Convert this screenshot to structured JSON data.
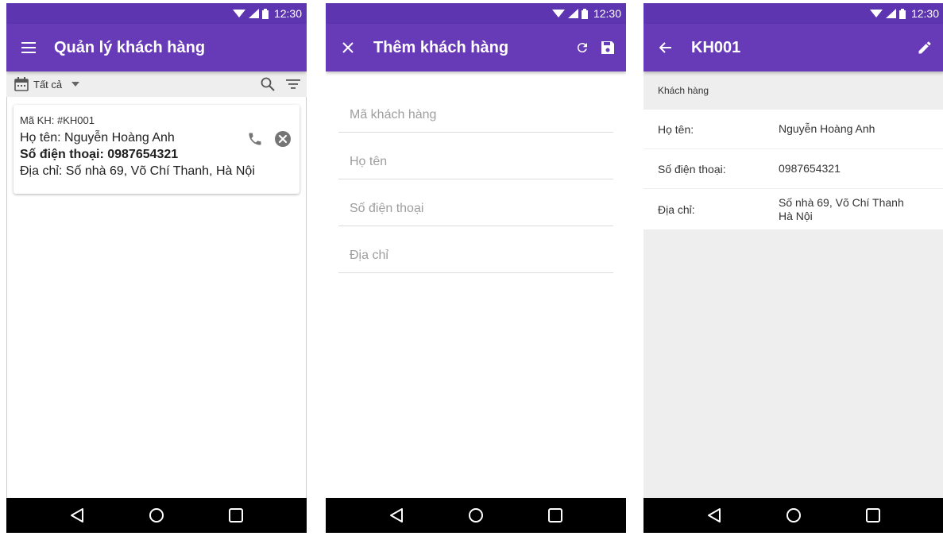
{
  "status": {
    "time": "12:30"
  },
  "screens": {
    "list": {
      "title": "Quản lý khách hàng",
      "filter_label": "Tất cả",
      "customer": {
        "code": "Mã KH: #KH001",
        "name": "Họ tên: Nguyễn Hoàng Anh",
        "phone": "Số điện thoại: 0987654321",
        "address": "Địa chỉ: Số nhà 69, Võ Chí Thanh, Hà Nội"
      }
    },
    "add": {
      "title": "Thêm khách hàng",
      "fields": {
        "code_placeholder": "Mã khách hàng",
        "name_placeholder": "Họ tên",
        "phone_placeholder": "Số điện thoại",
        "address_placeholder": "Địa chỉ"
      }
    },
    "detail": {
      "title": "KH001",
      "section": "Khách hàng",
      "rows": [
        {
          "label": "Họ tên:",
          "value": "Nguyễn Hoàng Anh"
        },
        {
          "label": "Số điện thoại:",
          "value": "0987654321"
        },
        {
          "label": "Địa chỉ:",
          "value": "Số nhà 69, Võ Chí Thanh Hà Nội"
        }
      ]
    }
  },
  "icons": {
    "menu": "menu-icon",
    "calendar": "calendar-icon",
    "dropdown": "dropdown-arrow-icon",
    "search": "search-icon",
    "filter": "filter-icon",
    "phone": "phone-icon",
    "delete": "delete-circle-icon",
    "close": "close-icon",
    "refresh": "refresh-icon",
    "save": "save-icon",
    "back": "arrow-back-icon",
    "edit": "edit-icon"
  },
  "colors": {
    "primary": "#673ab7",
    "status_bar": "#5e35b1",
    "nav_bar": "#000000"
  }
}
